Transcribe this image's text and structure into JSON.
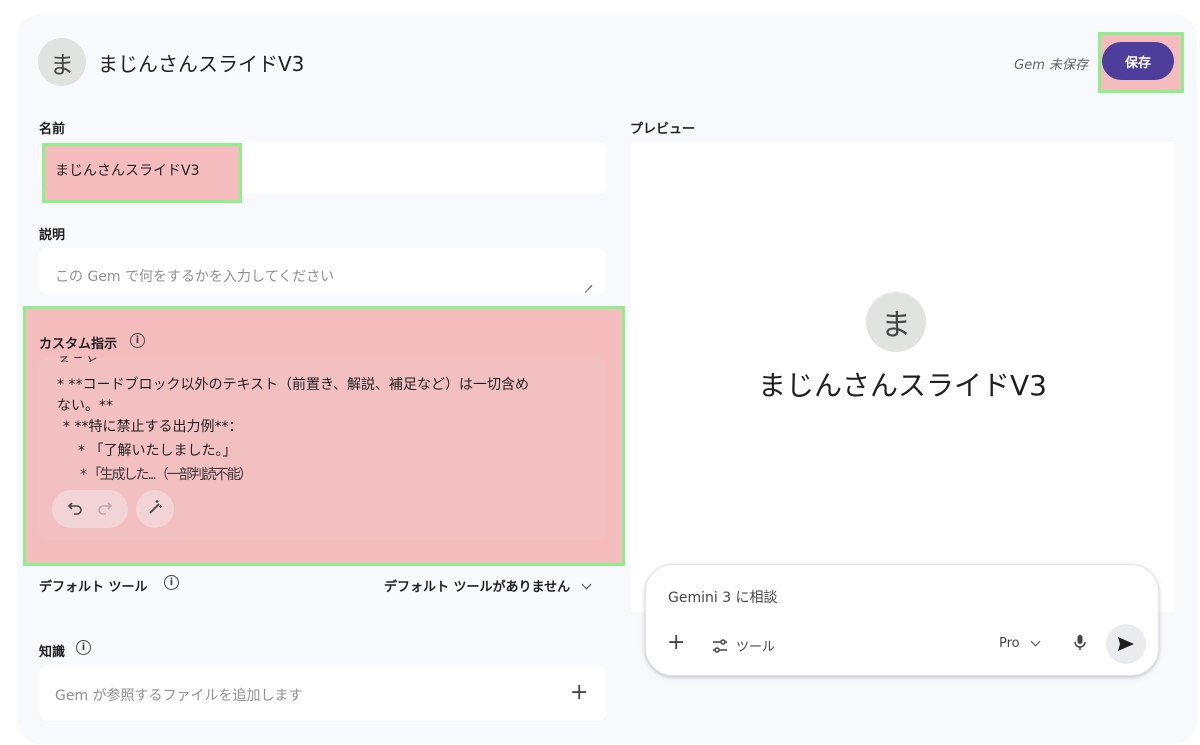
{
  "header": {
    "avatar_letter": "ま",
    "title": "まじんさんスライドV3",
    "unsaved_status": "Gem 未保存",
    "save_label": "保存"
  },
  "name": {
    "label": "名前",
    "value": "まじんさんスライドV3"
  },
  "description": {
    "label": "説明",
    "placeholder": "この Gem で何をするかを入力してください"
  },
  "custom_instructions": {
    "label": "カスタム指示",
    "info_icon": "info-icon",
    "lines": [
      "ること。",
      "* **コードブロック以外のテキスト（前置き、解説、補足など）は一切含め",
      "ない。**",
      "* **特に禁止する出力例**：",
      "* 「了解いたしました。」",
      "* 「生成した...（一部判読不能）"
    ],
    "toolbar": {
      "undo_icon": "undo-icon",
      "redo_icon": "redo-icon",
      "magic_icon": "magic-wand-icon"
    }
  },
  "default_tools": {
    "label": "デフォルト ツール",
    "value": "デフォルト ツールがありません"
  },
  "knowledge": {
    "label": "知識",
    "placeholder": "Gem が参照するファイルを追加します"
  },
  "preview": {
    "label": "プレビュー",
    "avatar_letter": "ま",
    "title": "まじんさんスライドV3",
    "chat": {
      "placeholder": "Gemini 3 に相談",
      "tools_label": "ツール",
      "model_label": "Pro"
    }
  },
  "colors": {
    "accent": "#4c3e9a",
    "highlight_fill": "#f4bcbd",
    "highlight_border": "#8ef08a"
  }
}
